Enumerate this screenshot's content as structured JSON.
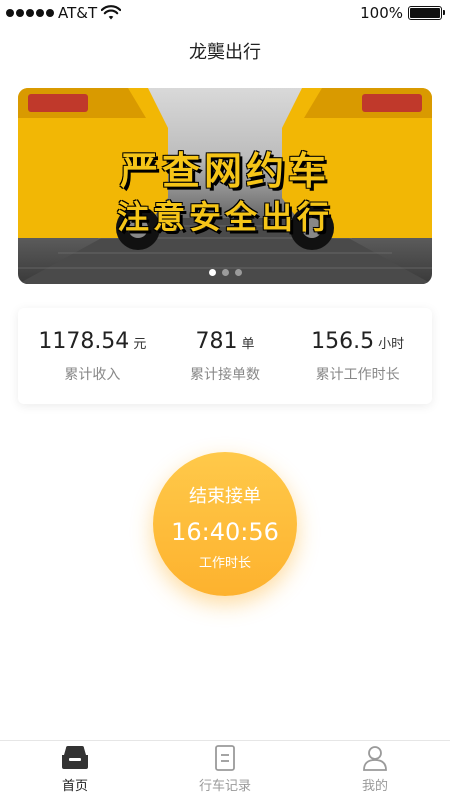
{
  "status_bar": {
    "carrier": "AT&T",
    "battery": "100%"
  },
  "nav": {
    "title": "龙龑出行"
  },
  "banner": {
    "line1": "严查网约车",
    "line2": "注意安全出行",
    "slide_count": 3,
    "active_index": 0
  },
  "stats": [
    {
      "value": "1178.54",
      "unit": "元",
      "label": "累计收入"
    },
    {
      "value": "781",
      "unit": "单",
      "label": "累计接单数"
    },
    {
      "value": "156.5",
      "unit": "小时",
      "label": "累计工作时长"
    }
  ],
  "work_button": {
    "label": "结束接单",
    "time": "16:40:56",
    "sub": "工作时长",
    "color": "#fdb22e"
  },
  "tabs": [
    {
      "label": "首页",
      "icon": "car-icon",
      "active": true
    },
    {
      "label": "行车记录",
      "icon": "document-icon",
      "active": false
    },
    {
      "label": "我的",
      "icon": "user-icon",
      "active": false
    }
  ]
}
